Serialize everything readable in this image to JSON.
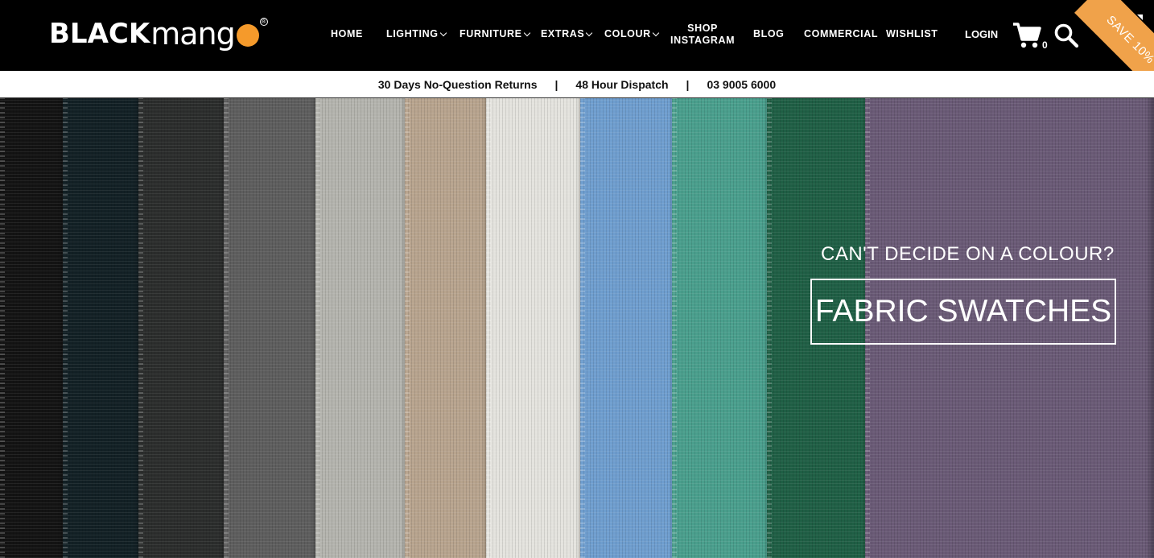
{
  "brand": {
    "logo_black": "BLACK",
    "logo_mang": "mang",
    "logo_reg": "®",
    "accent": "#f59a2b"
  },
  "nav": {
    "items": [
      {
        "label": "HOME",
        "dropdown": false
      },
      {
        "label": "LIGHTING",
        "dropdown": true
      },
      {
        "label": "FURNITURE",
        "dropdown": true
      },
      {
        "label": "EXTRAS",
        "dropdown": true
      },
      {
        "label": "COLOUR",
        "dropdown": true
      },
      {
        "label_line1": "SHOP",
        "label_line2": "INSTAGRAM",
        "dropdown": false
      },
      {
        "label": "BLOG",
        "dropdown": false
      },
      {
        "label": "COMMERCIAL",
        "dropdown": false
      },
      {
        "label": "WISHLIST",
        "dropdown": false
      }
    ],
    "login": "LOGIN",
    "cart_count": "0",
    "cart_icon": "cart-icon",
    "search_icon": "search-icon"
  },
  "promo": {
    "ribbon": "SAVE 10%",
    "ribbon_color": "#f0a24a"
  },
  "infobar": {
    "returns": "30 Days No-Question Returns",
    "separator": "|",
    "dispatch": "48 Hour Dispatch",
    "phone": "03 9005 6000"
  },
  "hero": {
    "question": "CAN'T DECIDE ON A COLOUR?",
    "button_label": "FABRIC SWATCHES",
    "swatch_colors": [
      "#131313",
      "#122025",
      "#2b2d2c",
      "#5e5e5e",
      "#b4b4ae",
      "#b8a48e",
      "#e4e3de",
      "#6f9ecf",
      "#4a9f8d",
      "#1f5f45",
      "#6a5a76"
    ]
  }
}
